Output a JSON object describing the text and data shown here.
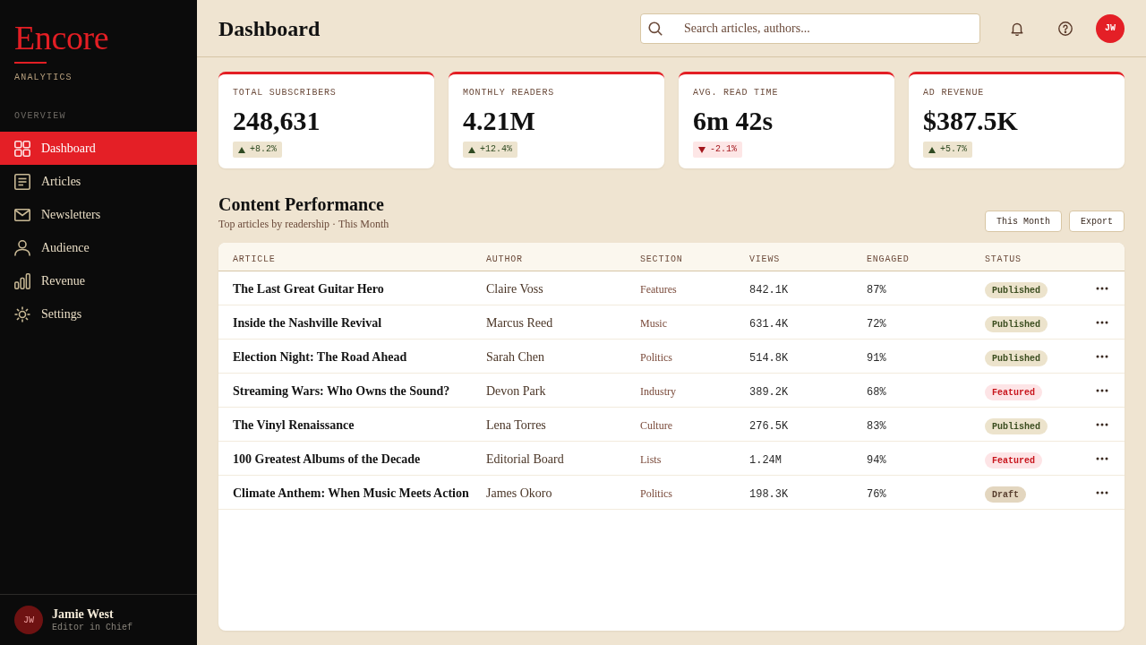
{
  "sidebar": {
    "logo": "Encore",
    "tagline": "ANALYTICS",
    "section_label": "OVERVIEW",
    "items": [
      {
        "label": "Dashboard",
        "selected": true
      },
      {
        "label": "Articles",
        "selected": false
      },
      {
        "label": "Newsletters",
        "selected": false
      },
      {
        "label": "Audience",
        "selected": false
      },
      {
        "label": "Revenue",
        "selected": false
      },
      {
        "label": "Settings",
        "selected": false
      }
    ],
    "user": {
      "initials": "JW",
      "name": "Jamie West",
      "role": "Editor in Chief"
    }
  },
  "header": {
    "title": "Dashboard",
    "search": {
      "placeholder": "Search articles, authors..."
    },
    "avatar": {
      "initials": "JW"
    }
  },
  "stats": [
    {
      "label": "TOTAL SUBSCRIBERS",
      "value": "248,631",
      "change": "+8.2%",
      "kind": "up"
    },
    {
      "label": "MONTHLY READERS",
      "value": "4.21M",
      "change": "+12.4%",
      "kind": "up"
    },
    {
      "label": "AVG. READ TIME",
      "value": "6m 42s",
      "change": "-2.1%",
      "kind": "down"
    },
    {
      "label": "AD REVENUE",
      "value": "$387.5K",
      "change": "+5.7%",
      "kind": "up"
    }
  ],
  "content": {
    "title": "Content Performance",
    "subtitle": "Top articles by readership · This Month",
    "buttons": [
      "This Month",
      "Export"
    ],
    "table": {
      "columns": [
        "ARTICLE",
        "AUTHOR",
        "SECTION",
        "VIEWS",
        "ENGAGED",
        "STATUS"
      ],
      "rows": [
        {
          "article": "The Last Great Guitar Hero",
          "author": "Claire Voss",
          "section": "Features",
          "views": "842.1K",
          "engaged": "87%",
          "status": {
            "label": "Published",
            "kind": "published"
          }
        },
        {
          "article": "Inside the Nashville Revival",
          "author": "Marcus Reed",
          "section": "Music",
          "views": "631.4K",
          "engaged": "72%",
          "status": {
            "label": "Published",
            "kind": "published"
          }
        },
        {
          "article": "Election Night: The Road Ahead",
          "author": "Sarah Chen",
          "section": "Politics",
          "views": "514.8K",
          "engaged": "91%",
          "status": {
            "label": "Published",
            "kind": "published"
          }
        },
        {
          "article": "Streaming Wars: Who Owns the Sound?",
          "author": "Devon Park",
          "section": "Industry",
          "views": "389.2K",
          "engaged": "68%",
          "status": {
            "label": "Featured",
            "kind": "featured"
          }
        },
        {
          "article": "The Vinyl Renaissance",
          "author": "Lena Torres",
          "section": "Culture",
          "views": "276.5K",
          "engaged": "83%",
          "status": {
            "label": "Published",
            "kind": "published"
          }
        },
        {
          "article": "100 Greatest Albums of the Decade",
          "author": "Editorial Board",
          "section": "Lists",
          "views": "1.24M",
          "engaged": "94%",
          "status": {
            "label": "Featured",
            "kind": "featured"
          }
        },
        {
          "article": "Climate Anthem: When Music Meets Action",
          "author": "James Okoro",
          "section": "Politics",
          "views": "198.3K",
          "engaged": "76%",
          "status": {
            "label": "Draft",
            "kind": "draft"
          }
        }
      ]
    }
  }
}
